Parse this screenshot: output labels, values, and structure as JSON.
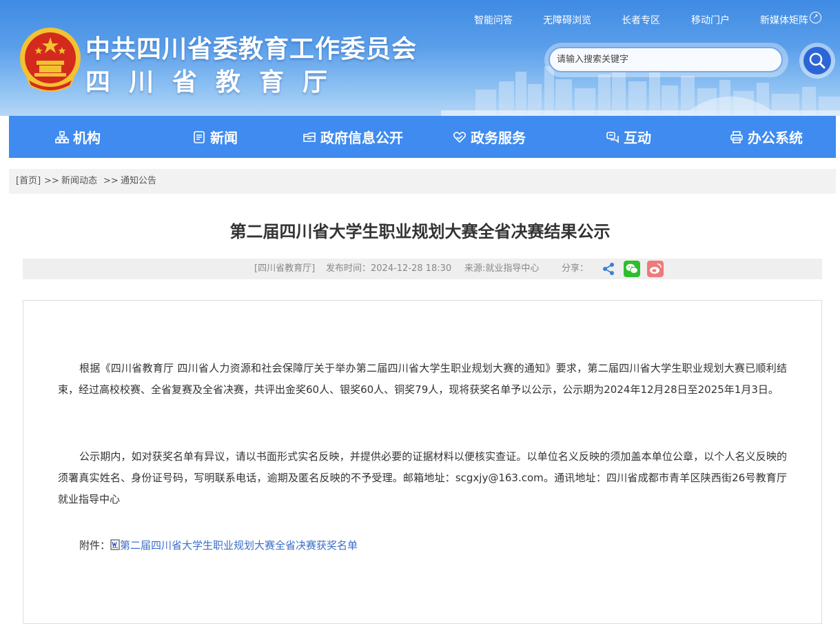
{
  "header": {
    "title_line1": "中共四川省委教育工作委员会",
    "title_line2": "四川省教育厅",
    "top_links": [
      "智能问答",
      "无障碍浏览",
      "长者专区",
      "移动门户",
      "新媒体矩阵"
    ],
    "search_placeholder": "请输入搜索关键字",
    "search_icon": "search-icon",
    "media_icon": "share-circle-icon"
  },
  "nav": {
    "items": [
      {
        "label": "机构",
        "icon": "org-chart-icon"
      },
      {
        "label": "新闻",
        "icon": "document-list-icon"
      },
      {
        "label": "政府信息公开",
        "icon": "folder-open-icon"
      },
      {
        "label": "政务服务",
        "icon": "heart-hand-icon"
      },
      {
        "label": "互动",
        "icon": "chat-icon"
      },
      {
        "label": "办公系统",
        "icon": "printer-icon"
      }
    ]
  },
  "breadcrumb": {
    "home": "[首页]",
    "sep": ">>",
    "level1": "新闻动态",
    "level2": "通知公告"
  },
  "article": {
    "title": "第二届四川省大学生职业规划大赛全省决赛结果公示",
    "meta": {
      "source_tag": "[四川省教育厅]",
      "publish_time": "发布时间：2024-12-28 18:30",
      "origin": "来源:就业指导中心",
      "share_label": "分享：",
      "share_icons": [
        "share-icon",
        "wechat-icon",
        "weibo-icon"
      ]
    },
    "paragraphs": [
      "根据《四川省教育厅 四川省人力资源和社会保障厅关于举办第二届四川省大学生职业规划大赛的通知》要求，第二届四川省大学生职业规划大赛已顺利结束，经过高校校赛、全省复赛及全省决赛，共评出金奖60人、银奖60人、铜奖79人，现将获奖名单予以公示，公示期为2024年12月28日至2025年1月3日。",
      "公示期内，如对获奖名单有异议，请以书面形式实名反映，并提供必要的证据材料以便核实查证。以单位名义反映的须加盖本单位公章，以个人名义反映的须署真实姓名、身份证号码，写明联系电话，逾期及匿名反映的不予受理。邮箱地址：scgxjy@163.com。通讯地址：四川省成都市青羊区陕西街26号教育厅就业指导中心"
    ],
    "attachment_label": "附件：",
    "attachment_link": "第二届四川省大学生职业规划大赛全省决赛获奖名单",
    "attachment_icon": "word-document-icon"
  },
  "colors": {
    "header_blue": "#3f8be3",
    "nav_blue": "#3f8bef",
    "search_button": "#2c66d6",
    "link_blue": "#3b6ec8",
    "emblem_red": "#d42a1e",
    "emblem_gold": "#f2c230",
    "wechat_green": "#2fbd2f",
    "weibo_pink": "#f0797a",
    "share_blue": "#3a7fd6"
  }
}
